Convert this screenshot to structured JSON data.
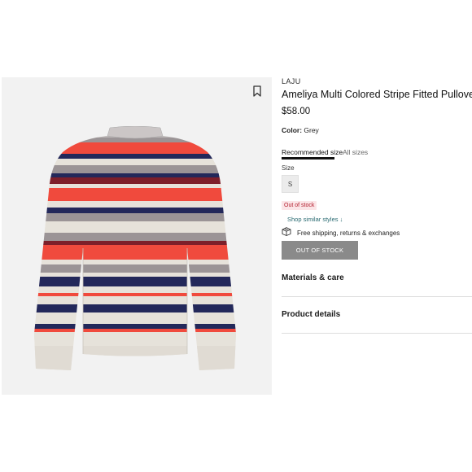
{
  "product": {
    "brand": "LAJU",
    "title": "Ameliya Multi Colored Stripe Fitted Pullover",
    "price": "$58.00",
    "color_label": "Color:",
    "color_value": " Grey"
  },
  "tabs": {
    "recommended": "Recommended size",
    "all": "All sizes"
  },
  "size": {
    "label": "Size",
    "options": [
      "S"
    ]
  },
  "stock": {
    "badge": "Out of stock",
    "button": "OUT OF STOCK"
  },
  "links": {
    "shop_similar": "Shop similar styles ↓"
  },
  "shipping": {
    "text": "Free shipping, returns & exchanges",
    "icon": "package-icon"
  },
  "accordions": {
    "materials": "Materials & care",
    "details": "Product details"
  },
  "icons": {
    "bookmark": "bookmark-icon"
  },
  "colors": {
    "stripe_red": "#f04a3d",
    "stripe_navy": "#23285a",
    "stripe_grey": "#9b9496",
    "stripe_cream": "#e6e2da",
    "stripe_maroon": "#7d1f2a",
    "badge_bg": "#fbe5e7",
    "badge_text": "#b3202f",
    "link": "#2a6b72",
    "button_bg": "#8a8a8a"
  }
}
